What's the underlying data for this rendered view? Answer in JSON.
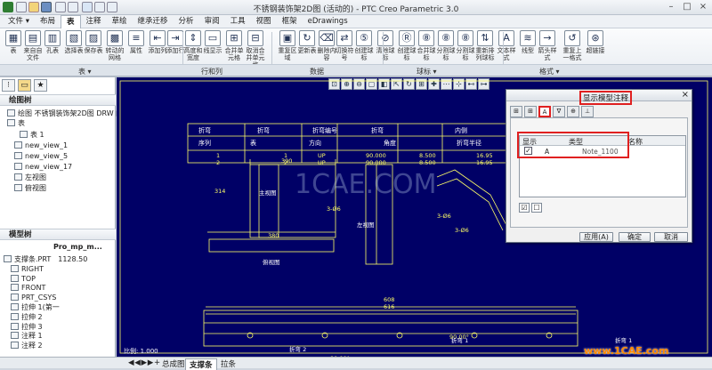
{
  "window": {
    "title": "不锈钢装饰架2D图 (活动的) - PTC Creo Parametric 3.0"
  },
  "menubar": {
    "tabs": [
      "文件 ▾",
      "布局",
      "表",
      "注释",
      "草绘",
      "继承迁移",
      "分析",
      "审阅",
      "工具",
      "视图",
      "框架",
      "eDrawings"
    ],
    "active_index": 2
  },
  "ribbon": {
    "buttons": [
      "表",
      "来自自文件",
      "孔表",
      "选择表",
      "保存表",
      "转动的网格",
      "属性",
      "添加列",
      "添加行",
      "高度和宽度",
      "线显示",
      "合并单元格",
      "取消合并单元格",
      "重复区域",
      "更新表",
      "删除内容",
      "切换符号",
      "创建球标",
      "清除球标",
      "创建球标",
      "合并球标",
      "分割球标",
      "分割球标",
      "重新排列球标",
      "文本样式",
      "线型",
      "箭头样式",
      "重复上一格式",
      "超链接"
    ],
    "groups": [
      "表 ▾",
      "行和列",
      "数据",
      "球标 ▾",
      "格式 ▾"
    ]
  },
  "left_panel": {
    "drawing_tree_title": "绘图树",
    "drawing_tree": [
      "绘图 不锈钢装饰架2D图 DRW 的表",
      "表",
      "表 1",
      "new_view_1",
      "new_view_5",
      "new_view_17",
      "左视图",
      "俯视图"
    ],
    "model_tree_title": "模型树",
    "model_tree_columns": [
      "Pro_mp_m..."
    ],
    "model_tree": [
      {
        "name": "支撑条.PRT",
        "value": "1128.50"
      },
      {
        "name": "RIGHT",
        "value": ""
      },
      {
        "name": "TOP",
        "value": ""
      },
      {
        "name": "FRONT",
        "value": ""
      },
      {
        "name": "PRT_CSYS",
        "value": ""
      },
      {
        "name": "拉伸 1(第一",
        "value": ""
      },
      {
        "name": "拉伸 2",
        "value": ""
      },
      {
        "name": "拉伸 3",
        "value": ""
      },
      {
        "name": "注释 1",
        "value": ""
      },
      {
        "name": "注释 2",
        "value": ""
      }
    ]
  },
  "table_drawing": {
    "headers_row1": [
      "折弯",
      "折弯",
      "折弯编号",
      "折弯",
      "内侧"
    ],
    "headers_row2": [
      "序列",
      "表",
      "方向",
      "角度",
      "折弯半径",
      "长度"
    ],
    "rows": [
      [
        "1",
        "1",
        "UP",
        "90.000",
        "8.500",
        "16.95"
      ],
      [
        "2",
        "2",
        "UP",
        "90.000",
        "8.500",
        "16.95"
      ]
    ],
    "dims": [
      "390",
      "380",
      "616",
      "608",
      "314",
      "3-Ø6",
      "3-Ø6",
      "3-Ø6",
      "90.00°",
      "90.00°"
    ],
    "view_labels": [
      "主视图",
      "左视图",
      "俯视图"
    ],
    "bend_labels": [
      "折弯 1",
      "折弯 1",
      "折弯 2"
    ],
    "scale_text": "比例: 1.000",
    "watermark": "1CAE.COM"
  },
  "dialog": {
    "title": "显示模型注释",
    "close": "×",
    "tabs": [
      "⊞",
      "⊞",
      "A",
      "∇",
      "⊕",
      "⊥"
    ],
    "columns": [
      "显示",
      "类型",
      "名称"
    ],
    "rows": [
      {
        "checked": true,
        "type": "A",
        "name": "Note_1100"
      }
    ],
    "buttons": [
      "应用(A)",
      "确定",
      "取消"
    ]
  },
  "statusbar": {
    "nav": "◀ ◀ ▶ ▶ +",
    "sheets": [
      "总成图",
      "支撑条",
      "拉条"
    ],
    "active_sheet": 1
  },
  "brand": "www.1CAE.com",
  "colors": {
    "canvas": "#000066",
    "line": "#ffff66",
    "accent_red": "#e02020"
  }
}
